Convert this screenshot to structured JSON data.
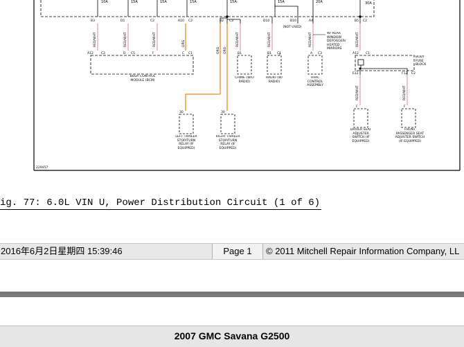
{
  "diagram": {
    "fuses": [
      "10A",
      "15A",
      "15A",
      "15A",
      "15A",
      "15A",
      "20A",
      "30A"
    ],
    "drop_codes": {
      "d1": [
        "B3",
        "D1",
        "C2",
        "A10",
        "C2"
      ],
      "d2": [
        "B2",
        "C3"
      ],
      "d3": [
        "D10"
      ],
      "d4": [
        "B10"
      ],
      "d5": [
        "A4"
      ],
      "d6": [
        "B5",
        "C2"
      ]
    },
    "not_used": "(NOT USED)",
    "wire_colors": {
      "red_wht": "RED/WHT",
      "org": "ORG"
    },
    "bcm": {
      "codes": [
        "A12",
        "C2",
        "D",
        "C5",
        "F",
        "C",
        "C1"
      ],
      "label": "BODY CONTROL MODULE (BCM)"
    },
    "chime": {
      "codes": [
        "B1"
      ],
      "label": "CHIME (W/O RADIO)"
    },
    "radio": {
      "codes": [
        "B1",
        "C1"
      ],
      "label": "RADIO (W/ RADIO)"
    },
    "hvac": {
      "codes": [
        "A",
        "C3"
      ],
      "label": "HVAC CONTROL ASSEMBLY"
    },
    "mirror_note": "W/ REAR WINDOW DEFOGGER/ HEATED MIRRORS",
    "body_fuse_block": {
      "codes": [
        "A12",
        "C1",
        "E12",
        "F12",
        "C2"
      ],
      "label": "BODY FUSE BLOCK"
    },
    "trailer_left": {
      "pin": "30",
      "label": "LEFT TRAILER STOP/TURN RELAY (IF EQUIPPED)"
    },
    "trailer_right": {
      "pin": "30",
      "label": "RIGHT TRAILER STOP/TURN RELAY (IF EQUIPPED)"
    },
    "driver_seat": {
      "pin": "F",
      "label": "DRIVER SEAT ADJUSTER SWITCH (IF EQUIPPED)"
    },
    "pass_seat": {
      "pin": "F",
      "label": "FRONT PASSENGER SEAT ADJUSTER SWITCH (IF EQUIPPED)"
    },
    "figure_id": "229457",
    "colors": {
      "orange_wire": "#f08a1c",
      "pink_wire": "#e8a0b8",
      "line": "#000000"
    }
  },
  "caption": "ig. 77: 6.0L VIN U, Power Distribution Circuit (1 of 6)",
  "footer": {
    "datetime": "2016年6月2日星期四  15:39:46",
    "page": "Page 1",
    "copyright": "© 2011 Mitchell Repair Information Company, LL"
  },
  "vehicle_title": "2007 GMC Savana G2500"
}
